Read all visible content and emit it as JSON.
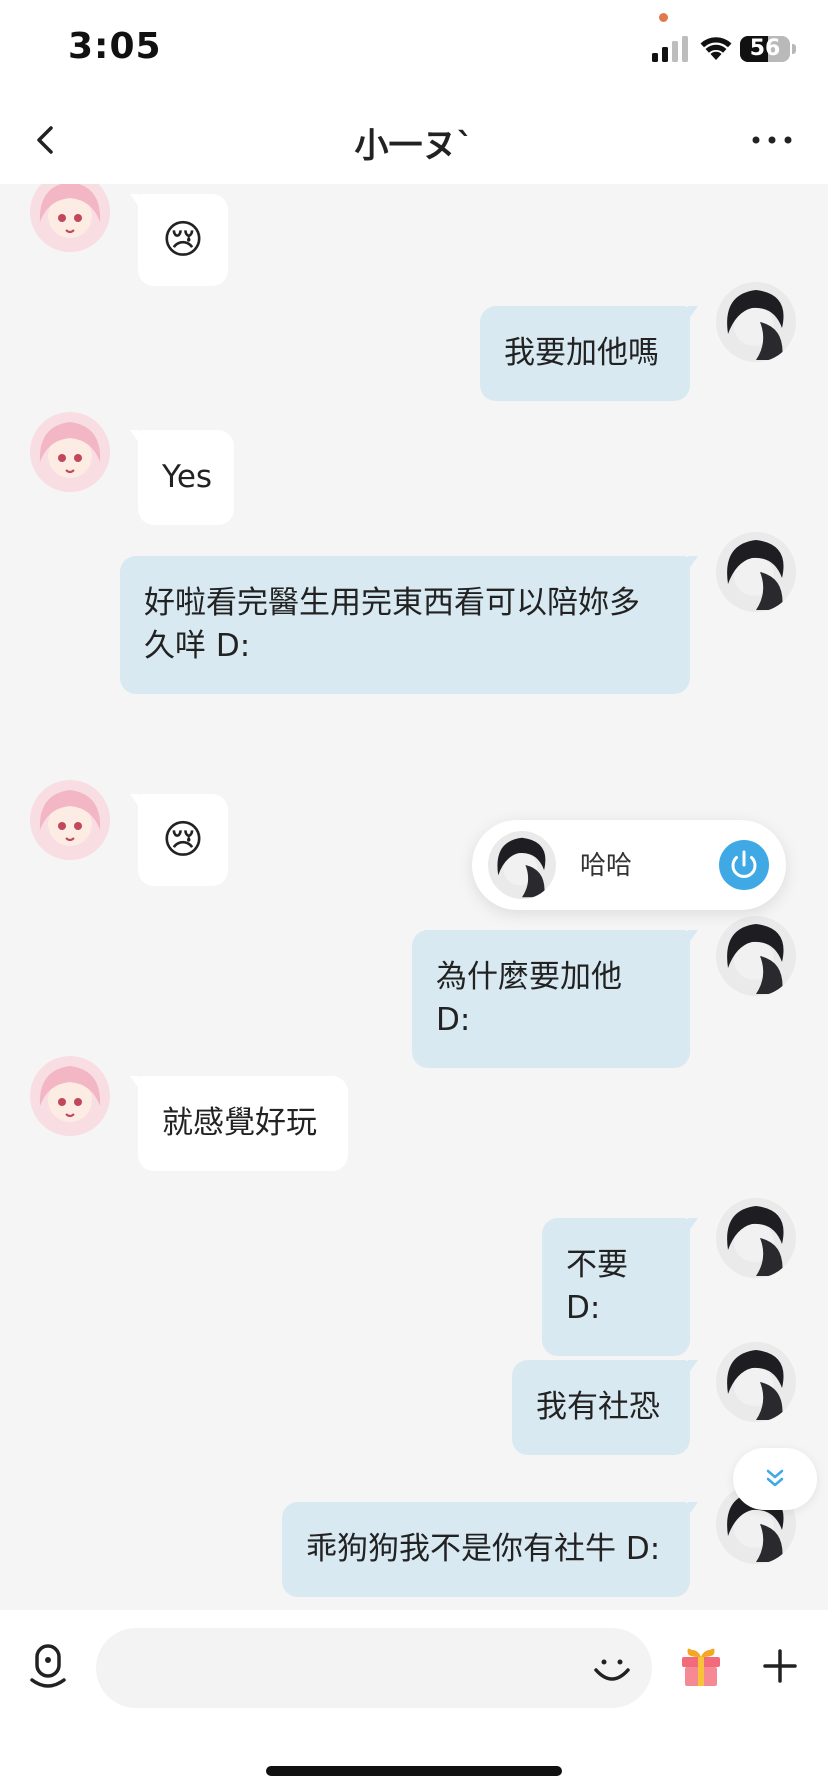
{
  "status_bar": {
    "time": "3:05",
    "battery": "56",
    "battery_level": 56
  },
  "header": {
    "title": "小一ヌ`"
  },
  "messages": [
    {
      "side": "left",
      "text": "😢",
      "emoji": true
    },
    {
      "side": "right",
      "text": "我要加他嗎"
    },
    {
      "side": "left",
      "text": "Yes"
    },
    {
      "side": "right",
      "text": "好啦看完醫生用完東西看可以陪妳多\n久咩 D:"
    },
    {
      "side": "left",
      "text": "😢",
      "emoji": true
    },
    {
      "side": "right",
      "text": "為什麼要加他 D:"
    },
    {
      "side": "left",
      "text": "就感覺好玩"
    },
    {
      "side": "right",
      "text": "不要 D:"
    },
    {
      "side": "right",
      "text": "我有社恐"
    },
    {
      "side": "right",
      "text": "乖狗狗我不是你有社牛 D:"
    }
  ],
  "voice_room": {
    "label": "哈哈"
  },
  "input_bar": {
    "value": "",
    "placeholder": ""
  },
  "colors": {
    "accent": "#3fa9e6",
    "bubble_self": "#d8e9f1",
    "bubble_other": "#ffffff",
    "background": "#f5f5f5"
  },
  "icons": {
    "back": "chevron-left-icon",
    "more": "more-dots-icon",
    "mic": "microphone-icon",
    "emoji": "smile-icon",
    "gift": "gift-icon",
    "add": "plus-icon",
    "power": "power-icon",
    "scroll": "double-chevron-down-icon"
  }
}
